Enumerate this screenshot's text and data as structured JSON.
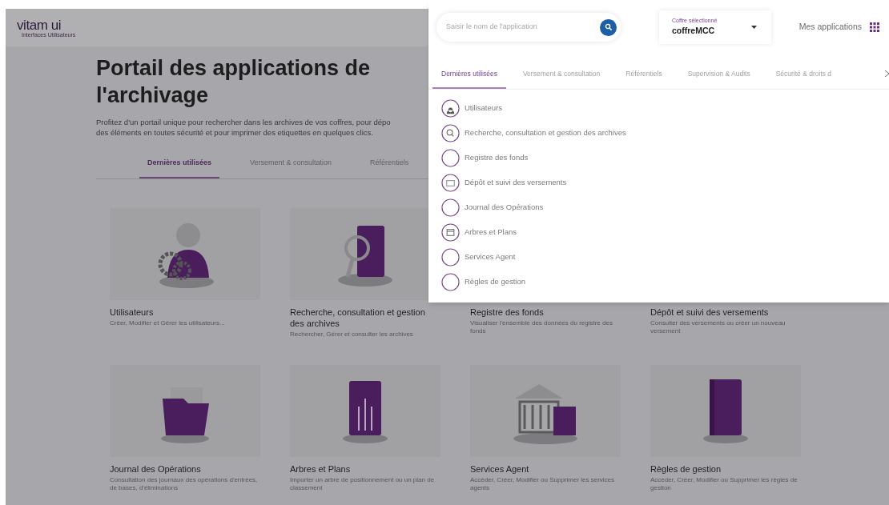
{
  "logo": {
    "text": "vitam ui",
    "subtitle": "Interfaces Utilisateurs"
  },
  "page": {
    "title": "Portail des applications de l'archivage",
    "description_lines": [
      "Profitez d'un portail unique pour rechercher dans les archives de vos coffres, pour dépo",
      "des éléments en toutes sécurité et pour imprimer des etiquettes en quelques clics."
    ]
  },
  "tabs": [
    {
      "label": "Dernières utilisées",
      "selected": true
    },
    {
      "label": "Versement & consultation",
      "selected": false
    },
    {
      "label": "Référentiels",
      "selected": false
    }
  ],
  "cards": [
    {
      "title": "Utilisateurs",
      "description": "Créer, Modifier et Gérer les utilisateurs...",
      "kind": "user-gears"
    },
    {
      "title": "Recherche, consultation et gestion des archives",
      "description": "Rechercher, Gérer et consulter les archives",
      "kind": "folder-search"
    },
    {
      "title": "Registre des fonds",
      "description": "Visualiser l'ensemble des données du registre des fonds",
      "kind": "hidden"
    },
    {
      "title": "Dépôt et suivi des versements",
      "description": "Consulter des versements ou créer un nouveau versement",
      "kind": "hidden"
    },
    {
      "title": "Journal des Opérations",
      "description": "Consultation des journaux des opérations d'entrées, de bases, d'éliminations",
      "kind": "folder-docs"
    },
    {
      "title": "Arbres et Plans",
      "description": "Importer un arbre de positionnement ou un plan de classement",
      "kind": "chip-book"
    },
    {
      "title": "Services Agent",
      "description": "Accéder, Créer, Modifier ou Supprimer les services agents",
      "kind": "bank"
    },
    {
      "title": "Règles de gestion",
      "description": "Accéder, Créer, Modifier ou Supprimer les règles de gestion",
      "kind": "rules-book"
    }
  ],
  "menu": {
    "search": {
      "placeholder": "Saisir le nom de l'application"
    },
    "vault": {
      "label": "Coffre sélectionné",
      "value": "coffreMCC"
    },
    "my_apps": "Mes applications",
    "tabs": [
      {
        "label": "Dernières utilisées",
        "selected": true
      },
      {
        "label": "Versement & consultation",
        "selected": false
      },
      {
        "label": "Référentiels",
        "selected": false
      },
      {
        "label": "Supervision & Audits",
        "selected": false
      },
      {
        "label": "Sécurité & droits d",
        "selected": false
      }
    ],
    "apps": [
      {
        "label": "Utilisateurs",
        "kind": "user"
      },
      {
        "label": "Recherche, consultation et gestion des archives",
        "kind": "search"
      },
      {
        "label": "Registre des fonds",
        "kind": "empty"
      },
      {
        "label": "Dépôt et suivi des versements",
        "kind": "inbox"
      },
      {
        "label": "Journal des Opérations",
        "kind": "empty"
      },
      {
        "label": "Arbres et Plans",
        "kind": "calendar"
      },
      {
        "label": "Services Agent",
        "kind": "empty"
      },
      {
        "label": "Règles de gestion",
        "kind": "empty"
      }
    ]
  }
}
